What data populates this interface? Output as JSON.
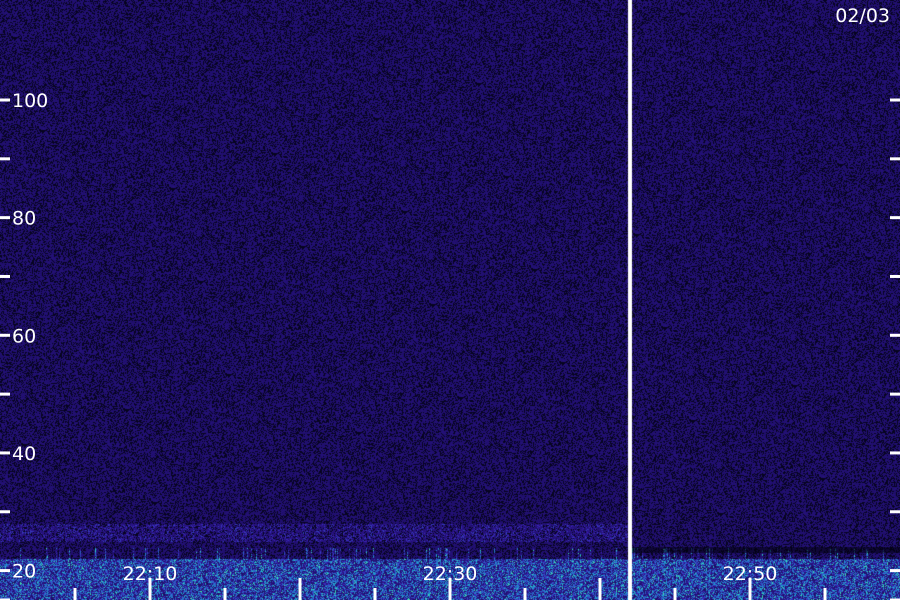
{
  "chart_data": {
    "type": "heatmap",
    "date_label": "02/03",
    "y_axis": {
      "range": [
        15,
        117
      ],
      "tick_labels": [
        "100",
        "80",
        "60",
        "40",
        "20"
      ],
      "labeled_tick_values": [
        100,
        80,
        60,
        40,
        20
      ],
      "minor_tick_values": [
        90,
        70,
        50,
        30,
        15
      ]
    },
    "x_axis": {
      "tick_labels": [
        "22:10",
        "22:30",
        "22:50"
      ],
      "labeled_tick_times": [
        "22:10",
        "22:30",
        "22:50"
      ],
      "range": [
        "22:00",
        "23:00"
      ]
    },
    "background_level": 0.15,
    "bands": [
      {
        "from": 25,
        "to": 28,
        "level": 0.35,
        "time_from": "22:00",
        "time_to": "22:42"
      },
      {
        "from": 15,
        "to": 22,
        "level": 0.75,
        "time_from": "22:00",
        "time_to": "23:00"
      }
    ],
    "gap_time": "22:42",
    "colors": {
      "low": "#1a0c5e",
      "mid": "#3d1eb8",
      "high": "#18b4d8",
      "peak": "#4cf0a0",
      "gap": "#ffffff"
    }
  }
}
